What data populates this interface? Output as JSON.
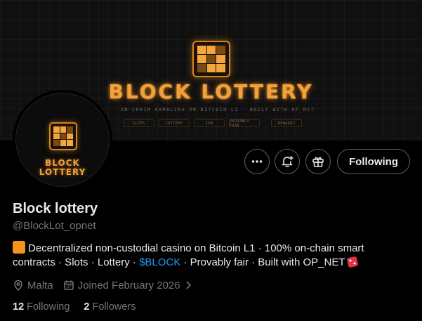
{
  "banner": {
    "title": "BLOCK LOTTERY",
    "tagline": "ON-CHAIN GAMBLING ON BITCOIN L1 · BUILT WITH OP_NET",
    "nav": [
      "SLOTS",
      "LOTTERY",
      "ION",
      "PROVABLY FAIR",
      "REWARDS"
    ]
  },
  "avatar": {
    "line1": "BLOCK",
    "line2": "LOTTERY"
  },
  "actions": {
    "more_icon": "more-horizontal-icon",
    "notify_icon": "bell-plus-icon",
    "gift_icon": "gift-icon",
    "following_label": "Following"
  },
  "profile": {
    "name": "Block lottery",
    "handle": "@BlockLot_opnet",
    "bio_part1": "Decentralized non-custodial casino on Bitcoin L1 · 100% on-chain smart contracts · Slots · Lottery · ",
    "bio_cashtag": "$BLOCK",
    "bio_part2": " · Provably fair · Built with OP_NET",
    "location": "Malta",
    "joined": "Joined February 2026"
  },
  "stats": {
    "following_count": "12",
    "following_label": "Following",
    "followers_count": "2",
    "followers_label": "Followers"
  },
  "colors": {
    "brand_orange": "#f2a13a",
    "link_blue": "#1d9bf0",
    "muted": "#71767b"
  }
}
